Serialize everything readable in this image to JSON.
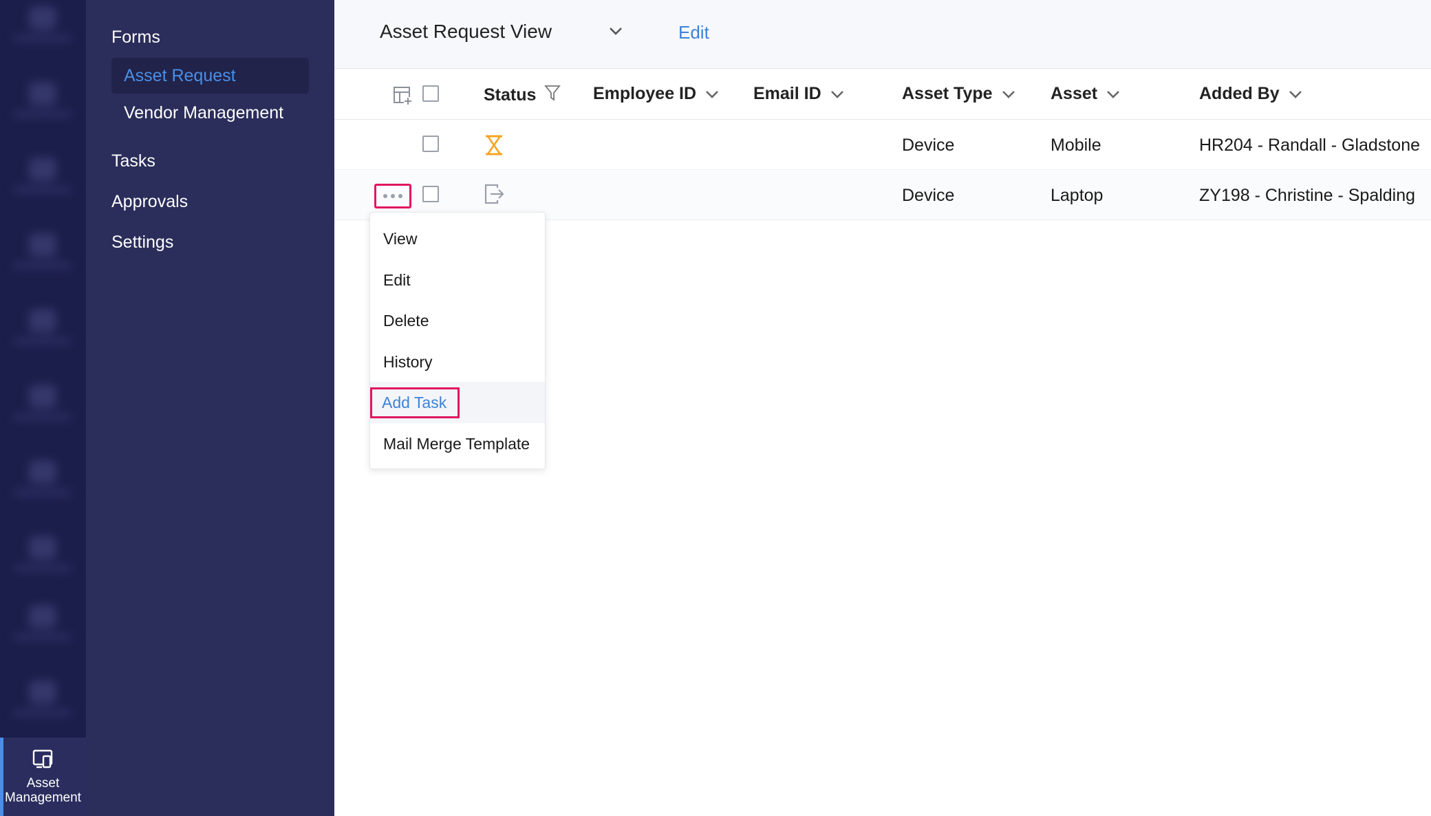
{
  "rail": {
    "active_label_line1": "Asset",
    "active_label_line2": "Management",
    "active_icon": "asset-management-icon"
  },
  "sidebar": {
    "forms_heading": "Forms",
    "forms_items": [
      {
        "label": "Asset Request",
        "active": true
      },
      {
        "label": "Vendor Management",
        "active": false
      }
    ],
    "tasks": "Tasks",
    "approvals": "Approvals",
    "settings": "Settings"
  },
  "topbar": {
    "view_title": "Asset Request View",
    "edit_label": "Edit"
  },
  "table": {
    "columns": {
      "status": "Status",
      "employee_id": "Employee ID",
      "email_id": "Email ID",
      "asset_type": "Asset Type",
      "asset": "Asset",
      "added_by": "Added By"
    },
    "rows": [
      {
        "status_icon": "hourglass-icon",
        "employee_id": "",
        "email_id": "",
        "asset_type": "Device",
        "asset": "Mobile",
        "added_by": "HR204 - Randall - Gladstone"
      },
      {
        "status_icon": "forward-arrow-icon",
        "employee_id": "",
        "email_id": "",
        "asset_type": "Device",
        "asset": "Laptop",
        "added_by": "ZY198 - Christine - Spalding"
      }
    ]
  },
  "context_menu": {
    "items": [
      "View",
      "Edit",
      "Delete",
      "History",
      "Add Task",
      "Mail Merge Template"
    ],
    "highlighted": "Add Task"
  },
  "colors": {
    "rail_bg": "#1b1d4a",
    "sidebar_bg": "#2b2d5a",
    "accent_blue": "#3d82d8",
    "highlight_pink": "#e0165f",
    "pending_orange": "#f5a623"
  }
}
